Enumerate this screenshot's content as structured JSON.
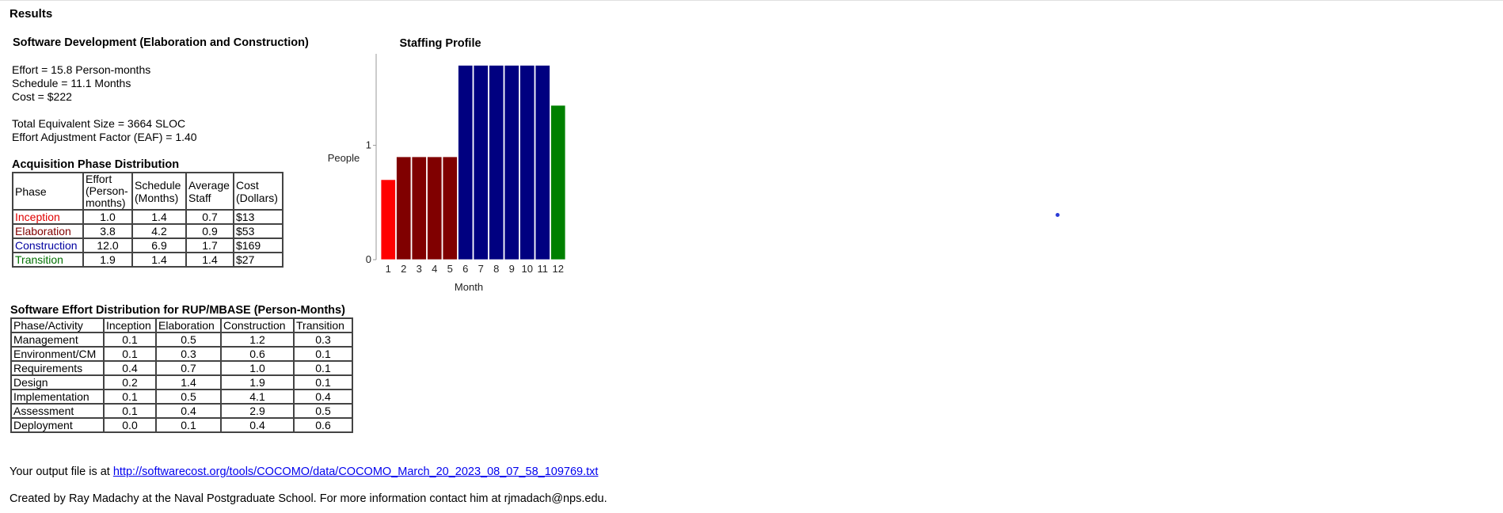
{
  "results_title": "Results",
  "software_dev": {
    "title": "Software Development (Elaboration and Construction)",
    "effort": "Effort = 15.8 Person-months",
    "schedule": "Schedule = 11.1 Months",
    "cost": "Cost = $222",
    "size": "Total Equivalent Size = 3664 SLOC",
    "eaf": "Effort Adjustment Factor (EAF) = 1.40"
  },
  "acquisition": {
    "title": "Acquisition Phase Distribution",
    "headers": [
      "Phase",
      "Effort (Person-months)",
      "Schedule (Months)",
      "Average Staff",
      "Cost (Dollars)"
    ],
    "header_lines": {
      "effort": [
        "Effort",
        "(Person-",
        "months)"
      ],
      "schedule": [
        "Schedule",
        "(Months)"
      ],
      "staff": [
        "Average",
        "Staff"
      ],
      "cost": [
        "Cost",
        "(Dollars)"
      ]
    },
    "rows": [
      {
        "phase": "Inception",
        "effort": "1.0",
        "schedule": "1.4",
        "staff": "0.7",
        "cost": "$13"
      },
      {
        "phase": "Elaboration",
        "effort": "3.8",
        "schedule": "4.2",
        "staff": "0.9",
        "cost": "$53"
      },
      {
        "phase": "Construction",
        "effort": "12.0",
        "schedule": "6.9",
        "staff": "1.7",
        "cost": "$169"
      },
      {
        "phase": "Transition",
        "effort": "1.9",
        "schedule": "1.4",
        "staff": "1.4",
        "cost": "$27"
      }
    ]
  },
  "effort_dist": {
    "title": "Software Effort Distribution for RUP/MBASE (Person-Months)",
    "headers": [
      "Phase/Activity",
      "Inception",
      "Elaboration",
      "Construction",
      "Transition"
    ],
    "rows": [
      {
        "activity": "Management",
        "inception": "0.1",
        "elaboration": "0.5",
        "construction": "1.2",
        "transition": "0.3"
      },
      {
        "activity": "Environment/CM",
        "inception": "0.1",
        "elaboration": "0.3",
        "construction": "0.6",
        "transition": "0.1"
      },
      {
        "activity": "Requirements",
        "inception": "0.4",
        "elaboration": "0.7",
        "construction": "1.0",
        "transition": "0.1"
      },
      {
        "activity": "Design",
        "inception": "0.2",
        "elaboration": "1.4",
        "construction": "1.9",
        "transition": "0.1"
      },
      {
        "activity": "Implementation",
        "inception": "0.1",
        "elaboration": "0.5",
        "construction": "4.1",
        "transition": "0.4"
      },
      {
        "activity": "Assessment",
        "inception": "0.1",
        "elaboration": "0.4",
        "construction": "2.9",
        "transition": "0.5"
      },
      {
        "activity": "Deployment",
        "inception": "0.0",
        "elaboration": "0.1",
        "construction": "0.4",
        "transition": "0.6"
      }
    ]
  },
  "footer": {
    "output_prefix": "Your output file is at",
    "output_link": "http://softwarecost.org/tools/COCOMO/data/COCOMO_March_20_2023_08_07_58_109769.txt",
    "credit": "Created by Ray Madachy at the Naval Postgraduate School. For more information contact him at rjmadach@nps.edu."
  },
  "colors": {
    "inception": "#ff0000",
    "elaboration": "#800000",
    "construction": "#000080",
    "transition": "#008000"
  },
  "chart_data": {
    "type": "bar",
    "title": "Staffing Profile",
    "xlabel": "Month",
    "ylabel": "People",
    "ylim": [
      0,
      1.8
    ],
    "yticks": [
      0,
      1
    ],
    "categories": [
      "1",
      "2",
      "3",
      "4",
      "5",
      "6",
      "7",
      "8",
      "9",
      "10",
      "11",
      "12"
    ],
    "values": [
      0.7,
      0.9,
      0.9,
      0.9,
      0.9,
      1.7,
      1.7,
      1.7,
      1.7,
      1.7,
      1.7,
      1.35
    ],
    "bar_phases": [
      "inception",
      "elaboration",
      "elaboration",
      "elaboration",
      "elaboration",
      "construction",
      "construction",
      "construction",
      "construction",
      "construction",
      "construction",
      "transition"
    ],
    "grid": false,
    "legend": "none"
  }
}
